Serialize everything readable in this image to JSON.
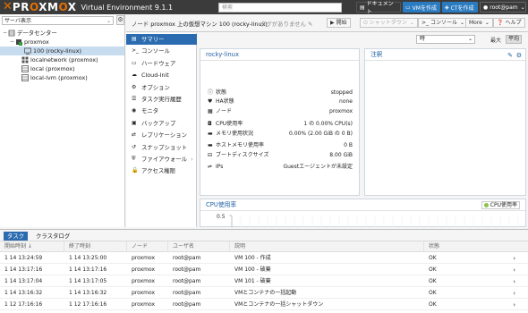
{
  "topbar": {
    "logo_x": "✕",
    "logo_brand_pre": "PR",
    "logo_brand_o": "O",
    "logo_brand_mid": "XM",
    "logo_brand_o2": "O",
    "logo_brand_end": "X",
    "version": "Virtual Environment 9.1.1",
    "search_placeholder": "検索",
    "doc_label": "ドキュメント",
    "create_vm_label": "VMを作成",
    "create_ct_label": "CTを作成",
    "user_label": "root@pam"
  },
  "tree": {
    "view": "サーバ表示",
    "datacenter": "データセンター",
    "node": "proxmox",
    "vm": "100 (rocky-linux)",
    "storages": [
      "localnetwork (proxmox)",
      "local (proxmox)",
      "local-lvm (proxmox)"
    ]
  },
  "content_header": {
    "title": "ノード proxmox 上の仮想マシン 100 (rocky-linux)",
    "tags": "タグがありません",
    "start": "開始",
    "shutdown": "シャットダウン",
    "console": "コンソール",
    "more": "More",
    "help": "ヘルプ"
  },
  "submenu": [
    {
      "label": "サマリー",
      "icon": "summary-icon",
      "glyph": "▤",
      "selected": true
    },
    {
      "label": "コンソール",
      "icon": "console-icon",
      "glyph": ">_"
    },
    {
      "label": "ハードウェア",
      "icon": "hardware-icon",
      "glyph": "▭"
    },
    {
      "label": "Cloud-Init",
      "icon": "cloud-icon",
      "glyph": "☁"
    },
    {
      "label": "オプション",
      "icon": "gear-icon",
      "glyph": "⚙"
    },
    {
      "label": "タスク実行履歴",
      "icon": "list-icon",
      "glyph": "☰"
    },
    {
      "label": "モニタ",
      "icon": "eye-icon",
      "glyph": "◉"
    },
    {
      "label": "バックアップ",
      "icon": "floppy-icon",
      "glyph": "▣"
    },
    {
      "label": "レプリケーション",
      "icon": "retweet-icon",
      "glyph": "⇄"
    },
    {
      "label": "スナップショット",
      "icon": "history-icon",
      "glyph": "↺"
    },
    {
      "label": "ファイアウォール",
      "icon": "shield-icon",
      "glyph": "⛨",
      "has_arrow": true
    },
    {
      "label": "アクセス権限",
      "icon": "unlock-icon",
      "glyph": "🔓"
    }
  ],
  "toolbar": {
    "timeframe": "時",
    "agg": "最大",
    "avg": "平均"
  },
  "status": {
    "name": "rocky-linux",
    "rows": [
      {
        "label": "状態",
        "value": "stopped",
        "icon": "info-icon",
        "glyph": "ⓘ"
      },
      {
        "label": "HA状態",
        "value": "none",
        "icon": "heartbeat-icon",
        "glyph": "♥"
      },
      {
        "label": "ノード",
        "value": "proxmox",
        "icon": "building-icon",
        "glyph": "▦"
      },
      {
        "label": "CPU使用率",
        "value": "1 の 0.00% CPU(s)",
        "icon": "cpu-icon",
        "glyph": "◘"
      },
      {
        "label": "メモリ使用状況",
        "value": "0.00% (2.00 GiB の 0 B)",
        "icon": "memory-icon",
        "glyph": "▬"
      },
      {
        "label": "ホストメモリ使用率",
        "value": "0 B",
        "icon": "memory-icon",
        "glyph": "▬"
      },
      {
        "label": "ブートディスクサイズ",
        "value": "8.00 GiB",
        "icon": "hdd-icon",
        "glyph": "⊟"
      },
      {
        "label": "IPs",
        "value": "Guestエージェントが未設定",
        "icon": "network-icon",
        "glyph": "⇌"
      }
    ]
  },
  "notes": {
    "title": "注釈"
  },
  "cpu_chart": {
    "title": "CPU使用率",
    "legend": "CPU使用率",
    "legend_color": "#8bc34a",
    "y_top": "0.5"
  },
  "log": {
    "tabs": [
      "タスク",
      "クラスタログ"
    ],
    "columns": [
      "開始時刻 ↓",
      "終了時刻",
      "ノード",
      "ユーザ名",
      "説明",
      "状態"
    ],
    "rows": [
      {
        "start": "1 14 13:24:59",
        "end": "1 14 13:25:00",
        "node": "proxmox",
        "user": "root@pam",
        "desc": "VM 100 - 作成",
        "status": "OK"
      },
      {
        "start": "1 14 13:17:16",
        "end": "1 14 13:17:16",
        "node": "proxmox",
        "user": "root@pam",
        "desc": "VM 100 - 破棄",
        "status": "OK"
      },
      {
        "start": "1 14 13:17:04",
        "end": "1 14 13:17:05",
        "node": "proxmox",
        "user": "root@pam",
        "desc": "VM 101 - 破棄",
        "status": "OK"
      },
      {
        "start": "1 14 13:16:32",
        "end": "1 14 13:16:32",
        "node": "proxmox",
        "user": "root@pam",
        "desc": "VMとコンテナの一括起動",
        "status": "OK"
      },
      {
        "start": "1 12 17:16:16",
        "end": "1 12 17:16:16",
        "node": "proxmox",
        "user": "root@pam",
        "desc": "VMとコンテナの一括シャットダウン",
        "status": "OK"
      }
    ]
  }
}
